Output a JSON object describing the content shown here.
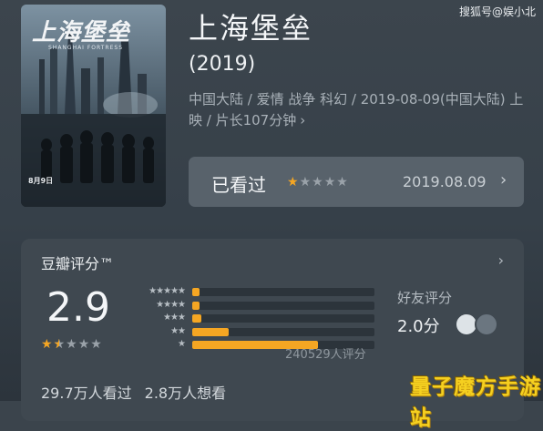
{
  "watermark": "搜狐号@娱小北",
  "poster": {
    "title": "上海堡垒",
    "subtitle": "SHANGHAI FORTRESS",
    "date": "8月9日"
  },
  "movie": {
    "title": "上海堡垒",
    "year": "(2019)",
    "meta": "中国大陆 / 爱情 战争 科幻 / 2019-08-09(中国大陆) 上映 / 片长107分钟",
    "meta_chevron": "›"
  },
  "watched": {
    "label": "已看过",
    "rating_stars": 1,
    "rating_max": 5,
    "date": "2019.08.09",
    "chevron": "›"
  },
  "douban": {
    "title": "豆瓣评分™",
    "chevron": "›",
    "score": "2.9",
    "score_stars": 1.5,
    "distribution": [
      {
        "stars": "★★★★★",
        "fraction": 0.04
      },
      {
        "stars": "★★★★",
        "fraction": 0.02
      },
      {
        "stars": "★★★",
        "fraction": 0.05
      },
      {
        "stars": "★★",
        "fraction": 0.2
      },
      {
        "stars": "★",
        "fraction": 0.69
      }
    ],
    "count": "240529人评分",
    "friend_title": "好友评分",
    "friend_score": "2.0分",
    "watched_count": "29.7万人看过",
    "want_count": "2.8万人想看"
  },
  "corner_logo": "量子魔方手游站",
  "colors": {
    "accent": "#f5a623",
    "background": "#3b444c",
    "card": "#3f4850"
  }
}
